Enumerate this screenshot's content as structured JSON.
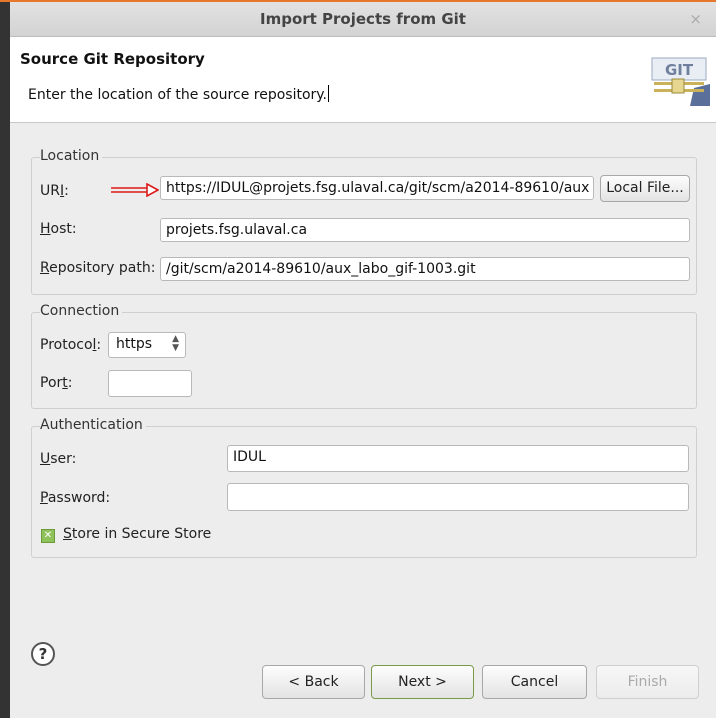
{
  "dialog": {
    "title": "Import Projects from Git",
    "close_glyph": "×"
  },
  "header": {
    "title": "Source Git Repository",
    "description": "Enter the location of the source repository.",
    "icon": "git-repository-icon",
    "icon_text": "GIT"
  },
  "location": {
    "group_label": "Location",
    "uri_label_pre": "UR",
    "uri_label_mnemonic": "I",
    "uri_label_post": ":",
    "uri_value": "https://IDUL@projets.fsg.ulaval.ca/git/scm/a2014-89610/aux",
    "local_file_button": "Local File...",
    "host_label_mnemonic": "H",
    "host_label_rest": "ost:",
    "host_value": "projets.fsg.ulaval.ca",
    "repo_label_mnemonic": "R",
    "repo_label_rest": "epository path:",
    "repo_value": "/git/scm/a2014-89610/aux_labo_gif-1003.git",
    "annotation_color": "#dd1a1a"
  },
  "connection": {
    "group_label": "Connection",
    "protocol_label_pre": "Protoco",
    "protocol_label_mnemonic": "l",
    "protocol_label_post": ":",
    "protocol_value": "https",
    "port_label_pre": "Por",
    "port_label_mnemonic": "t",
    "port_label_post": ":",
    "port_value": ""
  },
  "authentication": {
    "group_label": "Authentication",
    "user_label_mnemonic": "U",
    "user_label_rest": "ser:",
    "user_value": "IDUL",
    "password_label_mnemonic": "P",
    "password_label_rest": "assword:",
    "password_value": "",
    "store_mnemonic": "S",
    "store_rest": "tore in Secure Store",
    "store_checked": true
  },
  "footer": {
    "help_glyph": "?",
    "back_button": "< Back",
    "next_button": "Next >",
    "cancel_button": "Cancel",
    "finish_button": "Finish"
  }
}
